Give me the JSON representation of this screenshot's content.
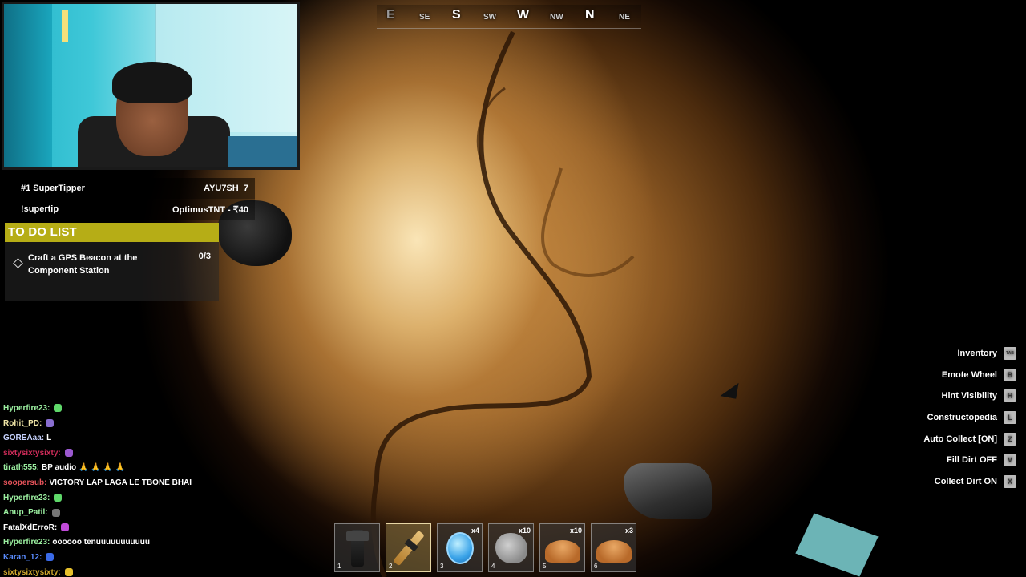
{
  "compass": {
    "labels": [
      {
        "text": "E",
        "kind": "major"
      },
      {
        "text": "SE",
        "kind": "minor"
      },
      {
        "text": "S",
        "kind": "major"
      },
      {
        "text": "SW",
        "kind": "minor"
      },
      {
        "text": "W",
        "kind": "major"
      },
      {
        "text": "NW",
        "kind": "minor"
      },
      {
        "text": "N",
        "kind": "major"
      },
      {
        "text": "NE",
        "kind": "minor"
      }
    ]
  },
  "tipper": {
    "title": "#1 SuperTipper",
    "top_user": "AYU7SH_7",
    "command": "!supertip",
    "latest": "OptimusTNT - ₹40"
  },
  "todo": {
    "header": "TO DO LIST",
    "task": "Craft a GPS Beacon at the Component Station",
    "progress": "0/3"
  },
  "chat": [
    {
      "user": "Hyperfire23:",
      "color": "#9cf0a1",
      "msg": "",
      "emote": "#5fd86a"
    },
    {
      "user": "Rohit_PD:",
      "color": "#f2e7a8",
      "msg": "",
      "emote": "#8a6fd1"
    },
    {
      "user": "GOREAaa:",
      "color": "#c7d3ff",
      "msg": "L",
      "emote": ""
    },
    {
      "user": "sixtysixtysixty:",
      "color": "#d12c5a",
      "msg": "",
      "emote": "#9b59d0"
    },
    {
      "user": "tirath555:",
      "color": "#9cf0a1",
      "msg": "BP audio 🙏 🙏 🙏 🙏",
      "emote": ""
    },
    {
      "user": "soopersub:",
      "color": "#e8545b",
      "msg": "VICTORY LAP LAGA LE TBONE BHAI",
      "emote": ""
    },
    {
      "user": "Hyperfire23:",
      "color": "#9cf0a1",
      "msg": "",
      "emote": "#5fd86a"
    },
    {
      "user": "Anup_Patil:",
      "color": "#9cf0a1",
      "msg": "",
      "emote": "#777777"
    },
    {
      "user": "FatalXdErroR:",
      "color": "#ffffff",
      "msg": "",
      "emote": "#c04ad8"
    },
    {
      "user": "Hyperfire23:",
      "color": "#9cf0a1",
      "msg": "oooooo tenuuuuuuuuuuu",
      "emote": ""
    },
    {
      "user": "Karan_12:",
      "color": "#5a8cff",
      "msg": "",
      "emote": "#3a6ae8"
    },
    {
      "user": "sixtysixtysixty:",
      "color": "#d1a82c",
      "msg": "",
      "emote": "#e6c02c"
    }
  ],
  "hints": [
    {
      "label": "Inventory",
      "key": "TAB"
    },
    {
      "label": "Emote Wheel",
      "key": "B"
    },
    {
      "label": "Hint Visibility",
      "key": "H"
    },
    {
      "label": "Constructopedia",
      "key": "L"
    },
    {
      "label": "Auto Collect [ON]",
      "key": "Z"
    },
    {
      "label": "Fill Dirt OFF",
      "key": "V"
    },
    {
      "label": "Collect Dirt ON",
      "key": "X"
    }
  ],
  "hotbar": [
    {
      "num": "1",
      "count": "",
      "icon": "hammer-icon",
      "selected": false
    },
    {
      "num": "2",
      "count": "",
      "icon": "drill-icon",
      "selected": true
    },
    {
      "num": "3",
      "count": "x4",
      "icon": "coin-icon",
      "selected": false
    },
    {
      "num": "4",
      "count": "x10",
      "icon": "rock-icon",
      "selected": false
    },
    {
      "num": "5",
      "count": "x10",
      "icon": "dirt-pile-icon",
      "selected": false
    },
    {
      "num": "6",
      "count": "x3",
      "icon": "dirt-pile-icon",
      "selected": false
    }
  ],
  "colors": {
    "todo_header": "#b6ad16",
    "dirt_light": "#f4d8a0",
    "dirt_dark": "#4a2a0d"
  }
}
